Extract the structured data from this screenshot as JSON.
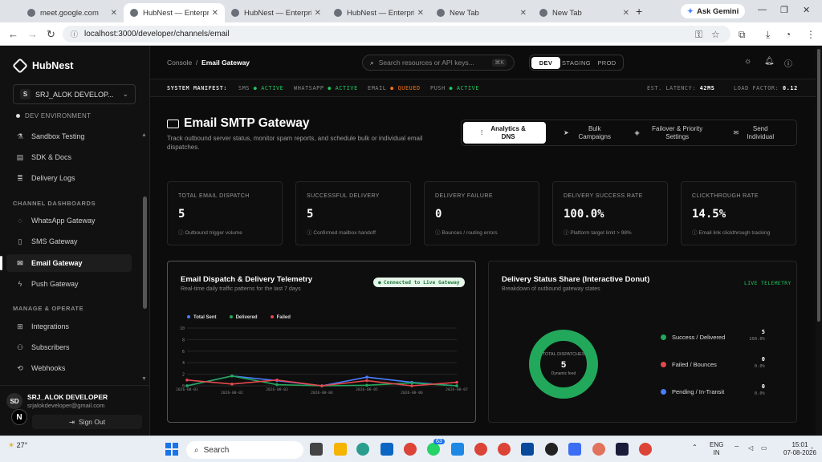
{
  "browser": {
    "tabs": [
      {
        "title": "meet.google.com",
        "active": false
      },
      {
        "title": "HubNest — Enterprise",
        "active": true
      },
      {
        "title": "HubNest — Enterprise",
        "active": false
      },
      {
        "title": "HubNest — Enterprise",
        "active": false
      },
      {
        "title": "New Tab",
        "active": false
      },
      {
        "title": "New Tab",
        "active": false
      }
    ],
    "gemini_label": "Ask Gemini",
    "url": "localhost:3000/developer/channels/email"
  },
  "sidebar": {
    "brand": "HubNest",
    "project": {
      "initial": "S",
      "name": "SRJ_ALOK DEVELOP..."
    },
    "env": "DEV ENVIRONMENT",
    "items_top": [
      {
        "label": "Sandbox Testing",
        "icon": "flask-icon"
      },
      {
        "label": "SDK & Docs",
        "icon": "book-icon"
      },
      {
        "label": "Delivery Logs",
        "icon": "list-icon"
      }
    ],
    "section_channels": "CHANNEL DASHBOARDS",
    "channels": [
      {
        "label": "WhatsApp Gateway",
        "icon": "chat-icon",
        "active": false
      },
      {
        "label": "SMS Gateway",
        "icon": "phone-icon",
        "active": false
      },
      {
        "label": "Email Gateway",
        "icon": "mail-icon",
        "active": true
      },
      {
        "label": "Push Gateway",
        "icon": "bolt-icon",
        "active": false
      }
    ],
    "section_manage": "MANAGE & OPERATE",
    "manage": [
      {
        "label": "Integrations",
        "icon": "grid-icon"
      },
      {
        "label": "Subscribers",
        "icon": "user-icon"
      },
      {
        "label": "Webhooks",
        "icon": "webhook-icon"
      }
    ],
    "user": {
      "initials": "SD",
      "name": "SRJ_ALOK DEVELOPER",
      "email": "srjalokdeveloper@gmail.com"
    },
    "signout": "Sign Out",
    "n_badge": "N"
  },
  "topnav": {
    "crumb_root": "Console",
    "crumb_sep": "/",
    "crumb_current": "Email Gateway",
    "search_placeholder": "Search resources or API keys...",
    "search_kbd": "⌘K",
    "envs": [
      "DEV",
      "STAGING",
      "PROD"
    ],
    "env_active": "DEV"
  },
  "manifest": {
    "label": "SYSTEM MANIFEST:",
    "items": [
      {
        "name": "SMS",
        "status": "ACTIVE"
      },
      {
        "name": "WHATSAPP",
        "status": "ACTIVE"
      },
      {
        "name": "EMAIL",
        "status": "QUEUED"
      },
      {
        "name": "PUSH",
        "status": "ACTIVE"
      }
    ],
    "latency_label": "EST. LATENCY:",
    "latency_value": "42MS",
    "load_label": "LOAD FACTOR:",
    "load_value": "0.12"
  },
  "page": {
    "title": "Email SMTP Gateway",
    "subtitle": "Track outbound server status, monitor spam reports, and schedule bulk or individual email dispatches.",
    "actions": [
      {
        "label": "Analytics & DNS",
        "icon": "chart-icon",
        "active": true
      },
      {
        "label": "Bulk Campaigns",
        "icon": "send-icon",
        "active": false
      },
      {
        "label": "Failover & Priority Settings",
        "icon": "layers-icon",
        "active": false
      },
      {
        "label": "Send Individual",
        "icon": "mail-icon",
        "active": false
      }
    ]
  },
  "kpis": [
    {
      "label": "TOTAL EMAIL DISPATCH",
      "value": "5",
      "foot": "Outbound trigger volume"
    },
    {
      "label": "SUCCESSFUL DELIVERY",
      "value": "5",
      "foot": "Confirmed mailbox handoff"
    },
    {
      "label": "DELIVERY FAILURE",
      "value": "0",
      "foot": "Bounces / routing errors"
    },
    {
      "label": "DELIVERY SUCCESS RATE",
      "value": "100.0%",
      "foot": "Platform target limit > 98%"
    },
    {
      "label": "CLICKTHROUGH RATE",
      "value": "14.5%",
      "foot": "Email link clickthrough tracking"
    }
  ],
  "telemetry": {
    "title": "Email Dispatch & Delivery Telemetry",
    "subtitle": "Real-time daily traffic patterns for the last 7 days",
    "badge": "Connected to Live Gateway",
    "colors": {
      "sent": "#4a7dff",
      "delivered": "#22a85a",
      "failed": "#e5484d"
    }
  },
  "chart_data": [
    {
      "type": "line",
      "title": "Email Dispatch & Delivery Telemetry",
      "x": [
        "2026-08-01",
        "2026-08-02",
        "2026-08-03",
        "2026-08-04",
        "2026-08-05",
        "2026-08-06",
        "2026-08-07"
      ],
      "yticks": [
        0,
        2,
        4,
        6,
        8,
        10
      ],
      "ylim": [
        0,
        10
      ],
      "legend": "top-left",
      "grid": true,
      "series": [
        {
          "name": "Total Sent",
          "color": "#4a7dff",
          "values": [
            0,
            1.7,
            0.9,
            0,
            1.5,
            0.6,
            0
          ]
        },
        {
          "name": "Delivered",
          "color": "#22a85a",
          "values": [
            0,
            1.7,
            0.2,
            0,
            0.1,
            0.5,
            0
          ]
        },
        {
          "name": "Failed",
          "color": "#e5484d",
          "values": [
            1,
            0.3,
            1,
            0,
            0.9,
            0,
            0.6
          ]
        }
      ]
    },
    {
      "type": "pie",
      "title": "Delivery Status Share (Interactive Donut)",
      "categories": [
        "Success / Delivered",
        "Failed / Bounces",
        "Pending / In-Transit"
      ],
      "values": [
        5,
        0,
        0
      ],
      "colors": [
        "#22a85a",
        "#e5484d",
        "#4a7dff"
      ]
    }
  ],
  "donut": {
    "title": "Delivery Status Share (Interactive Donut)",
    "subtitle": "Breakdown of outbound gateway states",
    "badge": "LIVE TELEMETRY",
    "center_label": "TOTAL DISPATCHES",
    "center_value": "5",
    "center_sub": "Dynamic feed",
    "legend": [
      {
        "label": "Success / Delivered",
        "count": "5",
        "pct": "100.0%",
        "color": "#22a85a"
      },
      {
        "label": "Failed / Bounces",
        "count": "0",
        "pct": "0.0%",
        "color": "#e5484d"
      },
      {
        "label": "Pending / In-Transit",
        "count": "0",
        "pct": "0.0%",
        "color": "#4a7dff"
      }
    ]
  },
  "taskbar": {
    "search": "Search",
    "temp": "27°",
    "lang1": "ENG",
    "lang2": "IN",
    "time": "15:01",
    "date": "07-08-2026",
    "badge": "63"
  }
}
